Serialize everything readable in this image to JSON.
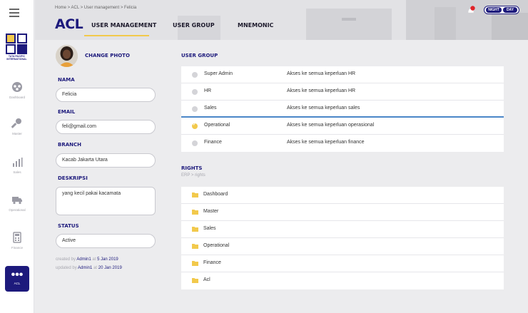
{
  "header": {
    "breadcrumb": "Home > ACL > User management > Felicia",
    "title": "ACL",
    "tabs": [
      {
        "label": "USER MANAGEMENT",
        "active": true
      },
      {
        "label": "USER GROUP",
        "active": false
      },
      {
        "label": "MNEMONIC",
        "active": false
      }
    ],
    "theme_toggle": {
      "night": "NIGHT",
      "day": "DAY",
      "selected": "DAY"
    }
  },
  "sidebar": {
    "logo_caption": "TATA PACIFIC INTERNATIONAL",
    "items": [
      {
        "label": "Dashboard",
        "icon": "dashboard-icon"
      },
      {
        "label": "Master",
        "icon": "key-icon"
      },
      {
        "label": "Sales",
        "icon": "sales-chart-icon"
      },
      {
        "label": "Operational",
        "icon": "truck-icon"
      },
      {
        "label": "Finance",
        "icon": "calculator-icon"
      },
      {
        "label": "ACL",
        "icon": "more-dots-icon",
        "active": true
      }
    ]
  },
  "profile": {
    "change_photo": "CHANGE PHOTO",
    "nama_label": "NAMA",
    "nama_value": "Felicia",
    "email_label": "EMAIL",
    "email_value": "feli@gmail.com",
    "branch_label": "BRANCH",
    "branch_value": "Kacab Jakarta Utara",
    "deskripsi_label": "DESKRIPSI",
    "deskripsi_value": "yang kecil pakai kacamata",
    "status_label": "STATUS",
    "status_value": "Active",
    "created_prefix": "created by",
    "created_by": "Admin1",
    "created_at_word": "at",
    "created_date": "5 Jan 2019",
    "updated_prefix": "updated by",
    "updated_by": "Admin1",
    "updated_at_word": "at",
    "updated_date": "20 Jan 2019"
  },
  "user_group": {
    "title": "USER GROUP",
    "rows": [
      {
        "name": "Super Admin",
        "desc": "Akses ke semua keperluan HR",
        "checked": false
      },
      {
        "name": "HR",
        "desc": "Akses ke semua keperluan HR",
        "checked": false
      },
      {
        "name": "Sales",
        "desc": "Akses ke semua keperluan sales",
        "checked": false
      },
      {
        "name": "Operational",
        "desc": "Akses ke semua keperluan operasional",
        "checked": true
      },
      {
        "name": "Finance",
        "desc": "Akses ke semua keperluan finance",
        "checked": false
      }
    ]
  },
  "rights": {
    "title": "RIGHTS",
    "subtitle": "ERP > rights",
    "items": [
      "Dashboard",
      "Master",
      "Sales",
      "Operational",
      "Finance",
      "Acl"
    ]
  },
  "colors": {
    "accent": "#1d1a7c",
    "highlight": "#f2c94c",
    "notify": "#e0242a"
  }
}
